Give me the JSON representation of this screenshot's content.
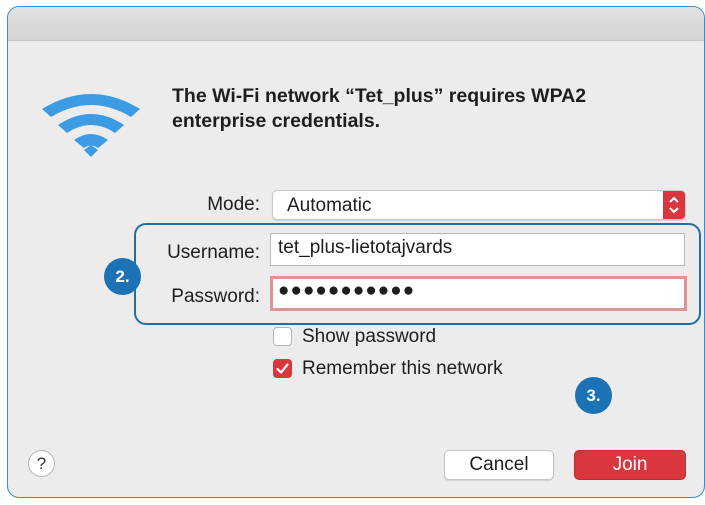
{
  "message": "The Wi-Fi network “Tet_plus” requires WPA2 enterprise credentials.",
  "mode": {
    "label": "Mode:",
    "value": "Automatic"
  },
  "username": {
    "label": "Username:",
    "value": "tet_plus-lietotajvards"
  },
  "password": {
    "label": "Password:",
    "value": "●●●●●●●●●●●"
  },
  "show_password": {
    "label": "Show password",
    "checked": false
  },
  "remember_network": {
    "label": "Remember this network",
    "checked": true
  },
  "badges": {
    "step2": "2.",
    "step3": "3."
  },
  "help": "?",
  "buttons": {
    "cancel": "Cancel",
    "join": "Join"
  },
  "colors": {
    "accent": "#d9363e",
    "annotation": "#1b72b4",
    "wifi": "#3d9be3"
  }
}
